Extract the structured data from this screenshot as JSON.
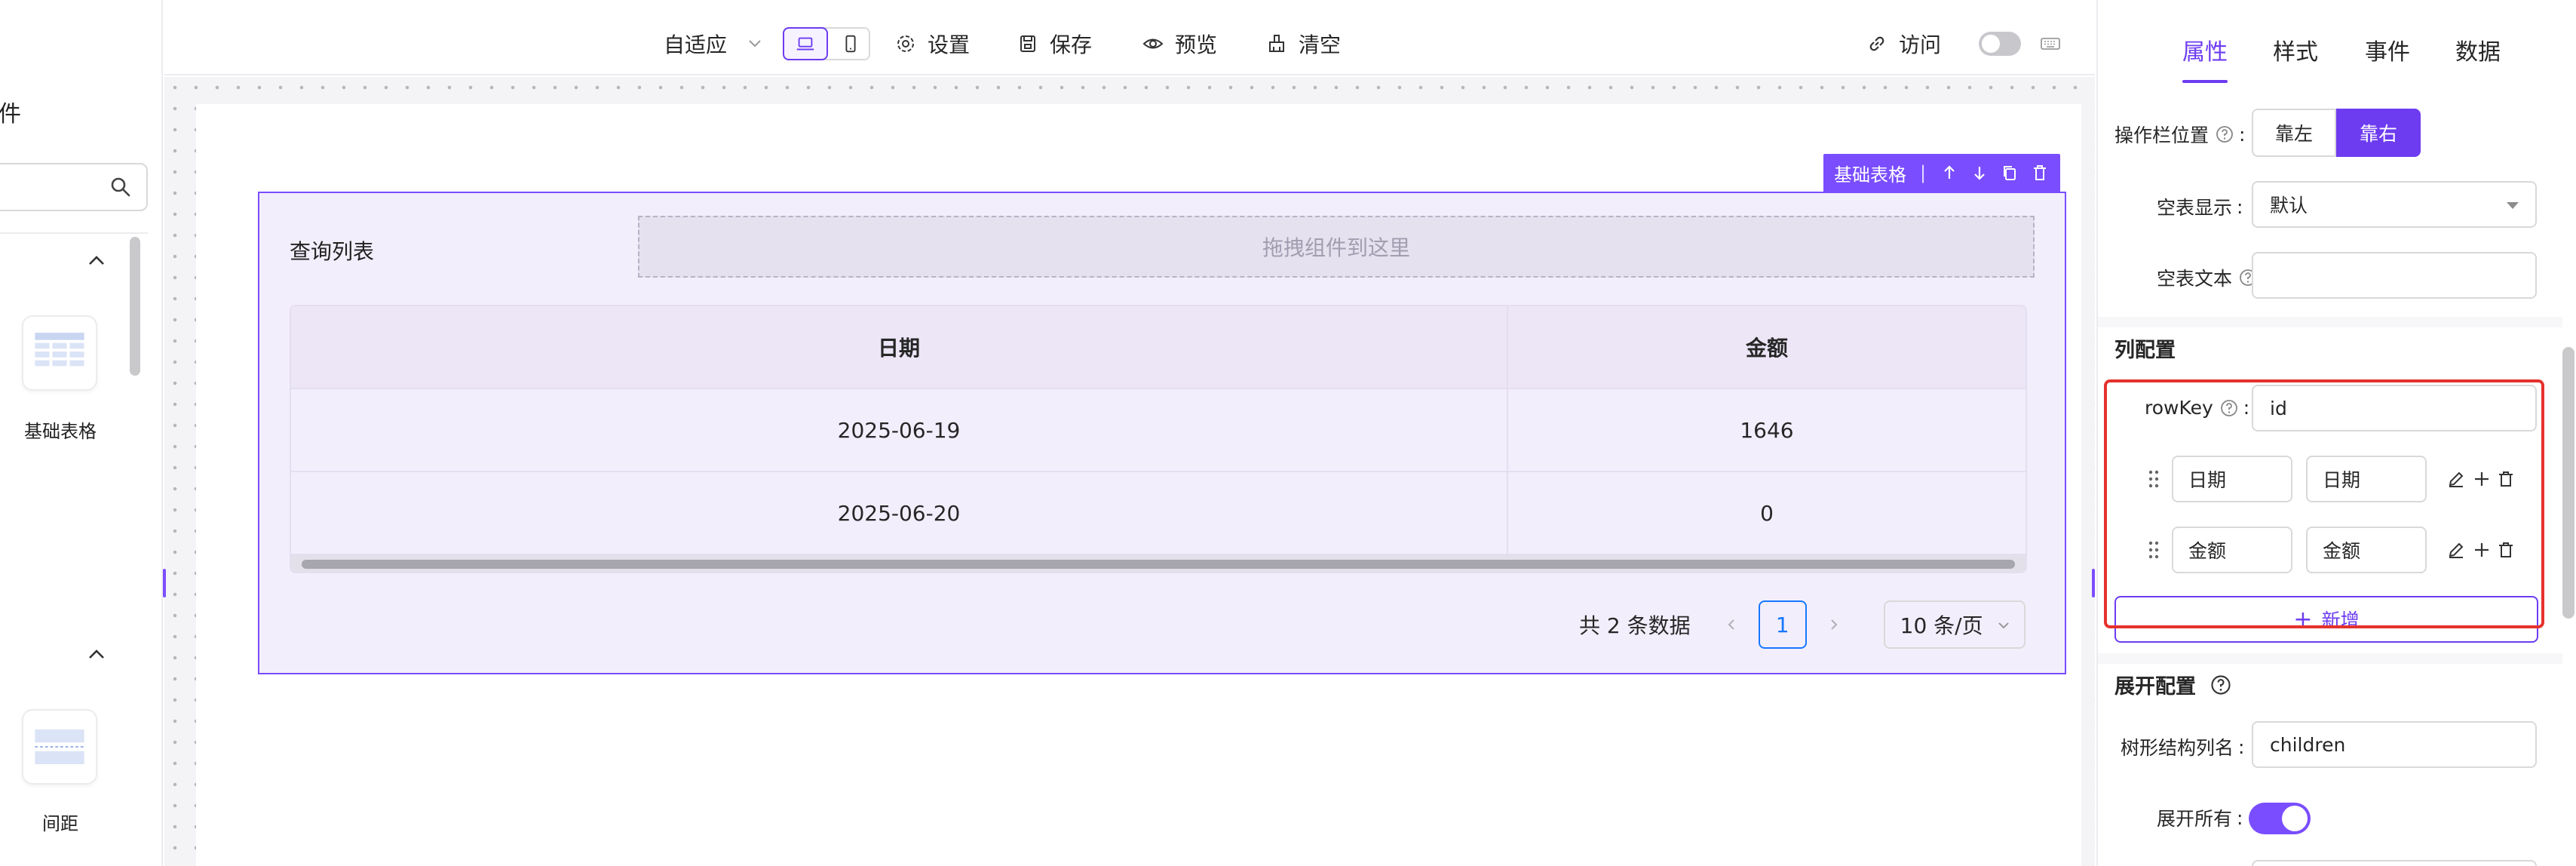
{
  "left_panel": {
    "title": "件",
    "search": {
      "placeholder": ""
    },
    "components": [
      {
        "label": "基础表格",
        "icon": "table-icon"
      },
      {
        "label": "间距",
        "icon": "spacing-icon"
      }
    ]
  },
  "toolbar": {
    "layout_mode": "自适应",
    "settings": "设置",
    "save": "保存",
    "preview": "预览",
    "clear": "清空",
    "visit": "访问"
  },
  "canvas": {
    "block_label": "基础表格",
    "query_title": "查询列表",
    "drop_hint": "拖拽组件到这里",
    "table": {
      "columns": [
        "日期",
        "金额"
      ],
      "rows": [
        [
          "2025-06-19",
          "1646"
        ],
        [
          "2025-06-20",
          "0"
        ]
      ]
    },
    "pagination": {
      "total": "共 2 条数据",
      "current_page": "1",
      "page_size": "10 条/页"
    }
  },
  "right_panel": {
    "tabs": [
      "属性",
      "样式",
      "事件",
      "数据"
    ],
    "active_tab": "属性",
    "action_bar_position": {
      "label": "操作栏位置",
      "options": [
        "靠左",
        "靠右"
      ],
      "selected": "靠右"
    },
    "empty_display": {
      "label": "空表显示",
      "value": "默认"
    },
    "empty_text": {
      "label": "空表文本",
      "value": ""
    },
    "column_config": {
      "title": "列配置",
      "row_key_label": "rowKey",
      "row_key_value": "id",
      "columns": [
        {
          "title": "日期",
          "field": "日期"
        },
        {
          "title": "金额",
          "field": "金额"
        }
      ],
      "add_label": "新增"
    },
    "expand_config": {
      "title": "展开配置",
      "tree_column_label": "树形结构列名",
      "tree_column_value": "children",
      "expand_all_label": "展开所有",
      "expand_all": true
    }
  },
  "colors": {
    "accent": "#6d3cf0",
    "highlight": "#e5322d",
    "page_blue": "#1677ff"
  }
}
